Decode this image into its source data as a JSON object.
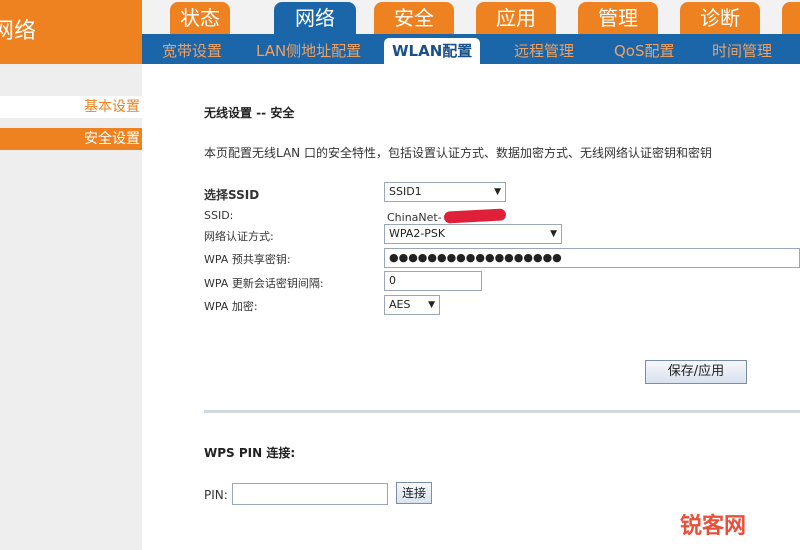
{
  "header": {
    "brand_text": "网络",
    "main_tabs": [
      {
        "label": "状态"
      },
      {
        "label": "网络"
      },
      {
        "label": "安全"
      },
      {
        "label": "应用"
      },
      {
        "label": "管理"
      },
      {
        "label": "诊断"
      }
    ],
    "active_main_tab": "网络",
    "sub_tabs": [
      {
        "label": "宽带设置"
      },
      {
        "label": "LAN侧地址配置"
      },
      {
        "label": "WLAN配置"
      },
      {
        "label": "远程管理"
      },
      {
        "label": "QoS配置"
      },
      {
        "label": "时间管理"
      }
    ],
    "active_sub_tab": "WLAN配置"
  },
  "sidebar": {
    "items": [
      {
        "label": "基本设置"
      },
      {
        "label": "安全设置"
      }
    ],
    "active_item": "安全设置"
  },
  "main": {
    "section_title": "无线设置 -- 安全",
    "description": "本页配置无线LAN 口的安全特性，包括设置认证方式、数据加密方式、无线网络认证密钥和密钥",
    "form": {
      "select_ssid_label": "选择SSID",
      "select_ssid_value": "SSID1",
      "ssid_label": "SSID:",
      "ssid_value": "ChinaNet-",
      "auth_label": "网络认证方式:",
      "auth_value": "WPA2-PSK",
      "psk_label": "WPA 预共享密钥:",
      "psk_value": "●●●●●●●●●●●●●●●●●●",
      "rekey_label": "WPA 更新会话密钥间隔:",
      "rekey_value": "0",
      "algo_label": "WPA 加密:",
      "algo_value": "AES",
      "dropdown_arrow": "▼"
    },
    "save_button": "保存/应用",
    "wps": {
      "title": "WPS PIN 连接:",
      "pin_label": "PIN:",
      "pin_value": "",
      "connect_button": "连接"
    }
  },
  "watermark": "锐客网",
  "colors": {
    "orange": "#ef8220",
    "blue": "#1a66a8",
    "sidebar_bg": "#eeeeee"
  }
}
